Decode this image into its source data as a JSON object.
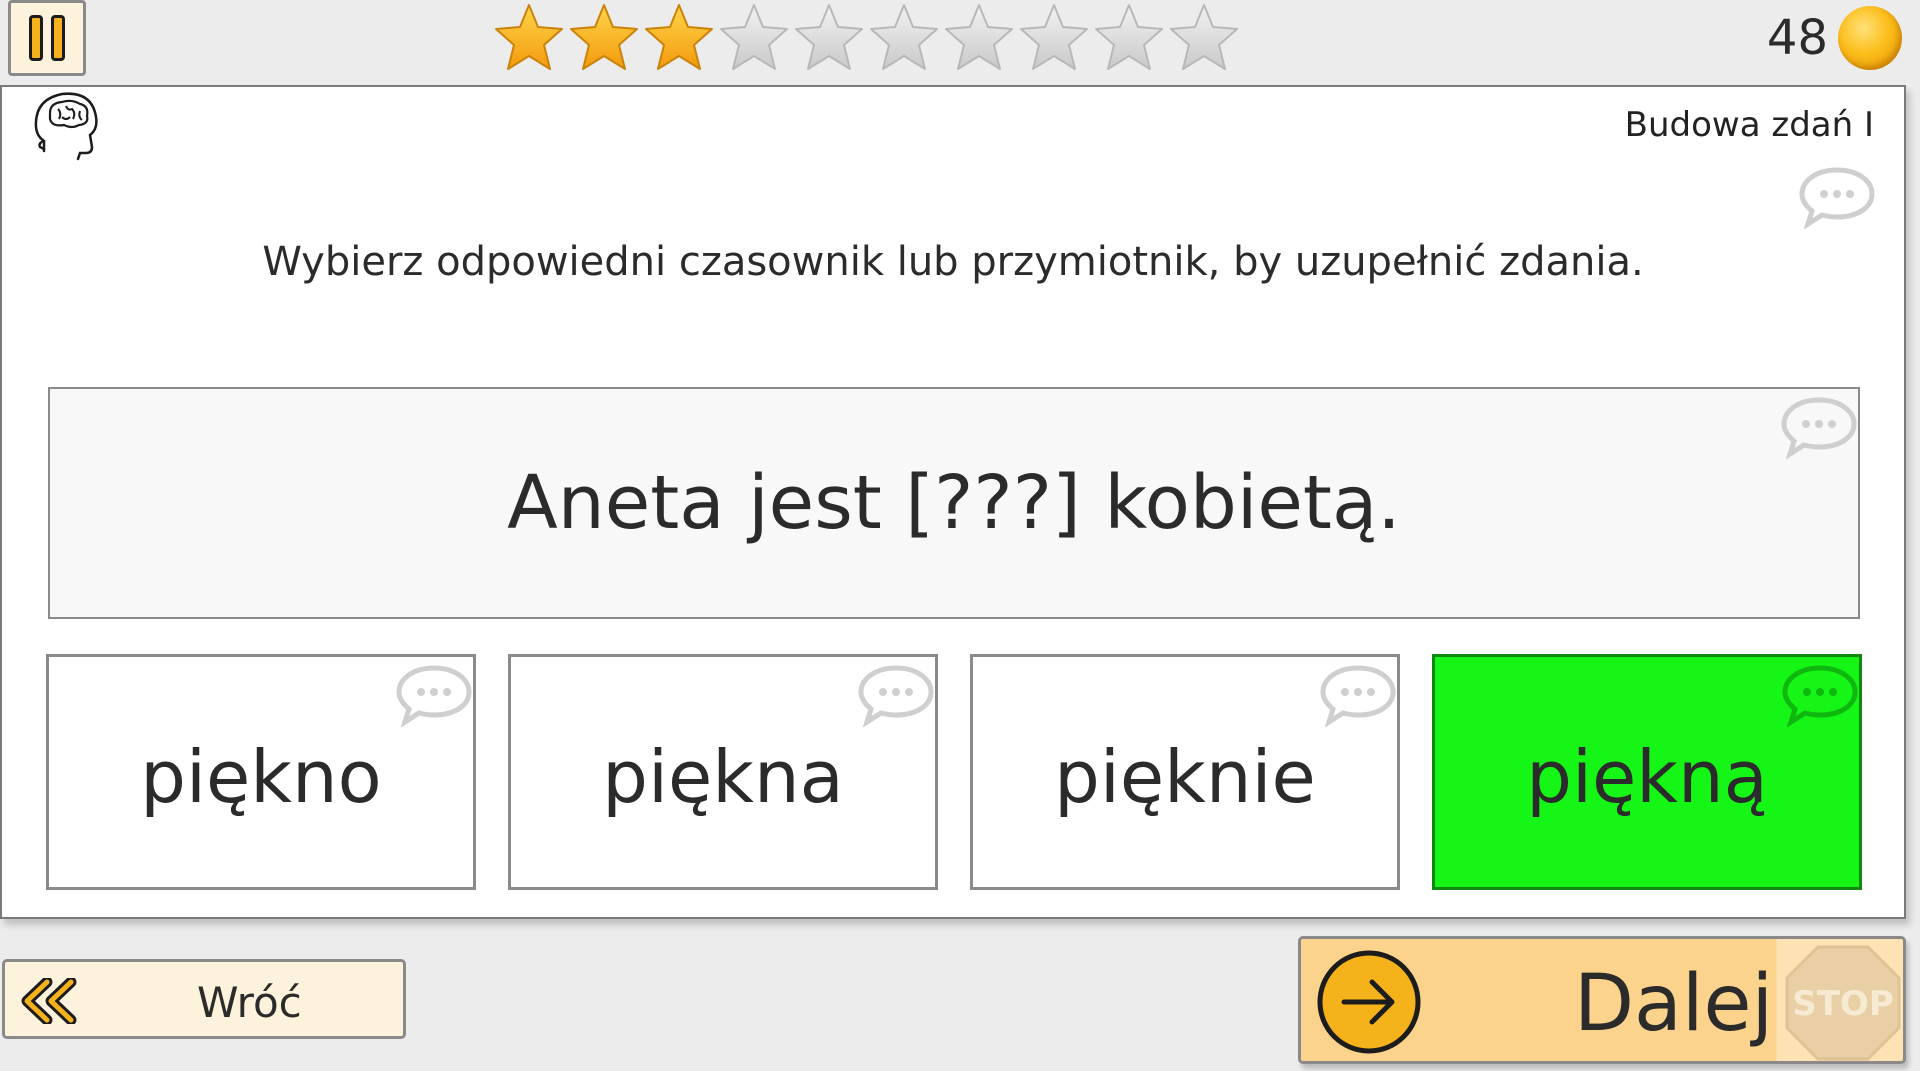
{
  "header": {
    "pause_icon": "pause-icon",
    "stars": {
      "filled": 3,
      "total": 10
    },
    "coins": "48",
    "coin_icon": "coin-icon"
  },
  "lesson": {
    "title": "Budowa zdań I",
    "brain_icon": "brain-head-icon",
    "instruction": "Wybierz odpowiedni czasownik lub przymiotnik, by uzupełnić zdania.",
    "sentence": "Aneta jest [???] kobietą.",
    "options": [
      {
        "label": "piękno",
        "correct": false
      },
      {
        "label": "piękna",
        "correct": false
      },
      {
        "label": "pięknie",
        "correct": false
      },
      {
        "label": "piękną",
        "correct": true
      }
    ]
  },
  "footer": {
    "back_label": "Wróć",
    "next_label": "Dalej",
    "stop_label": "STOP"
  },
  "colors": {
    "correct": "#16f616",
    "star_filled": "#f8b41c",
    "star_empty": "#d8d8d8",
    "button_bg": "#fdf3dc",
    "next_bg": "#fbd38c"
  }
}
